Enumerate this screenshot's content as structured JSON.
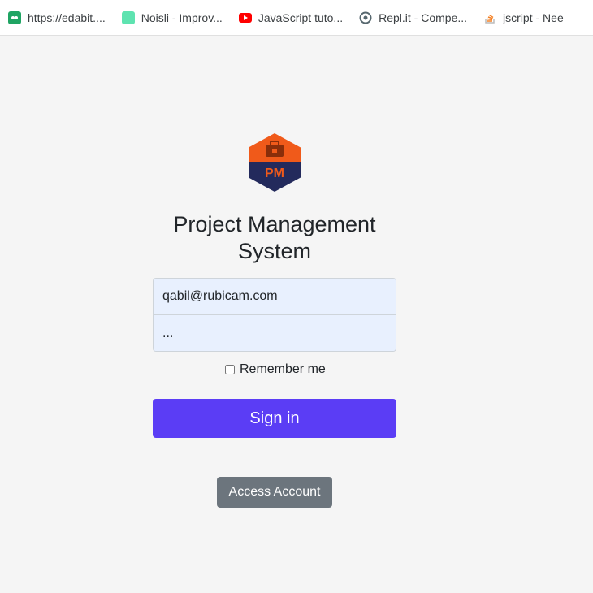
{
  "bookmarks": [
    {
      "label": "https://edabit....",
      "icon": "edabit-icon"
    },
    {
      "label": "Noisli - Improv...",
      "icon": "noisli-icon"
    },
    {
      "label": "JavaScript tuto...",
      "icon": "youtube-icon"
    },
    {
      "label": "Repl.it - Compe...",
      "icon": "replit-icon"
    },
    {
      "label": "jscript - Nee",
      "icon": "stackoverflow-icon"
    }
  ],
  "logo": {
    "text": "PM",
    "top_color": "#f05a1a",
    "bottom_color": "#232a5c"
  },
  "title": "Project Management System",
  "form": {
    "email_value": "qabil@rubicam.com",
    "password_value": "...",
    "remember_label": "Remember me",
    "signin_label": "Sign in"
  },
  "access_label": "Access Account",
  "colors": {
    "primary": "#5b3df5",
    "secondary": "#6c757d",
    "input_bg": "#e8f0fe",
    "background": "#f5f5f5"
  }
}
